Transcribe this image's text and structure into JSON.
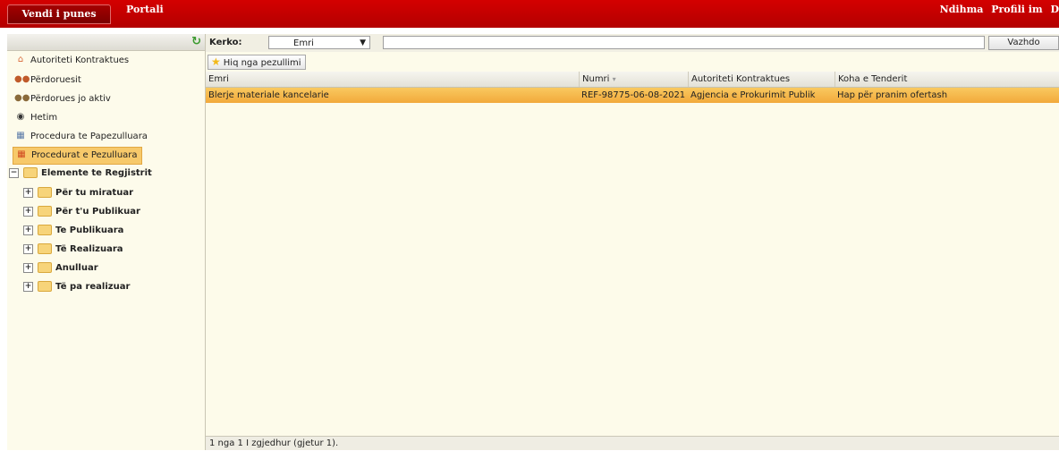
{
  "topbar": {
    "active_tab": "Vendi i punes",
    "tab_portali": "Portali",
    "links": [
      "Ndihma",
      "Profili im",
      "D"
    ]
  },
  "sidebar": {
    "items": [
      {
        "label": "Autoriteti Kontraktues",
        "icon": "building-icon"
      },
      {
        "label": "Përdoruesit",
        "icon": "users-icon"
      },
      {
        "label": "Përdorues jo aktiv",
        "icon": "inactive-users-icon"
      },
      {
        "label": "Hetim",
        "icon": "investigation-icon"
      },
      {
        "label": "Procedura te Papezulluara",
        "icon": "calendar-icon"
      },
      {
        "label": "Procedurat e Pezulluara",
        "icon": "suspended-calendar-icon"
      }
    ],
    "tree_root": "Elemente te Regjistrit",
    "tree_children": [
      "Për tu miratuar",
      "Për t'u Publikuar",
      "Te Publikuara",
      "Të Realizuara",
      "Anulluar",
      "Të pa realizuar"
    ]
  },
  "search": {
    "label": "Kerko:",
    "selected": "Emri",
    "value": "",
    "button": "Vazhdo"
  },
  "toolbar": {
    "button": "Hiq nga pezullimi"
  },
  "table": {
    "columns": [
      "Emri",
      "Numri",
      "Autoriteti Kontraktues",
      "Koha e Tenderit"
    ],
    "rows": [
      [
        "Blerje materiale kancelarie",
        "REF-98775-06-08-2021",
        "Agjencia e Prokurimit Publik",
        "Hap për pranim ofertash"
      ]
    ]
  },
  "status": "1 nga 1 I zgjedhur (gjetur 1).",
  "colors": {
    "brand": "#c80000",
    "selection": "#f5b84a",
    "panel": "#fdfbea"
  }
}
